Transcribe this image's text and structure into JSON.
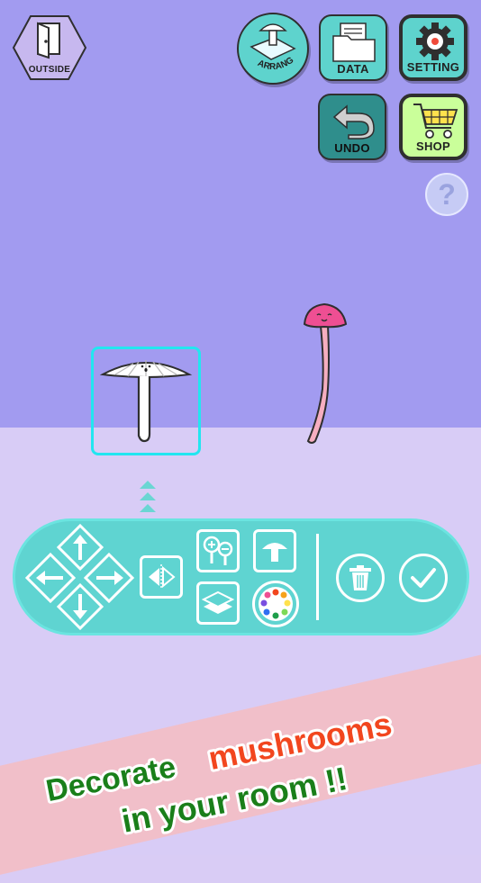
{
  "topbar": {
    "outside_label": "OUTSIDE",
    "arrange_label": "ARRANGE",
    "data_label": "DATA",
    "setting_label": "SETTING",
    "undo_label": "UNDO",
    "shop_label": "SHOP",
    "help_label": "?"
  },
  "promo": {
    "line1_part1": "Decorate",
    "line1_part2": "mushrooms",
    "line2": "in your room !!"
  },
  "colors": {
    "wall": "#a29bf0",
    "floor": "#d8ccf6",
    "panel": "#5fd4d1",
    "selection": "#22e6f0",
    "shop": "#caff9a",
    "undo": "#2f8e8c",
    "promo_green": "#1a7f1a",
    "promo_red": "#f2461e",
    "banner": "#f1bfc9"
  },
  "icons": {
    "outside": "door-icon",
    "arrange": "mushroom-arrange-icon",
    "data": "folder-icon",
    "setting": "gear-icon",
    "undo": "undo-arrow-icon",
    "shop": "cart-icon",
    "up": "arrow-up-icon",
    "down": "arrow-down-icon",
    "left": "arrow-left-icon",
    "right": "arrow-right-icon",
    "flip": "flip-icon",
    "zoom": "zoom-in-out-icon",
    "mushroom_select": "mushroom-icon",
    "layers": "layers-icon",
    "palette": "palette-icon",
    "trash": "trash-icon",
    "confirm": "check-icon"
  }
}
